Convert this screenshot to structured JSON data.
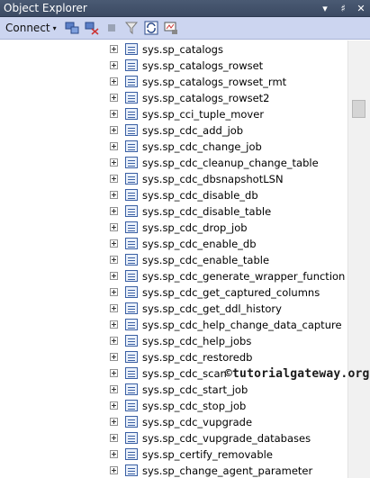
{
  "window": {
    "title": "Object Explorer"
  },
  "window_controls": {
    "dropdown": "▾",
    "pin": "♯",
    "close": "✕"
  },
  "toolbar": {
    "connect_label": "Connect",
    "connect_caret": "▾"
  },
  "tree": {
    "items": [
      "sys.sp_catalogs",
      "sys.sp_catalogs_rowset",
      "sys.sp_catalogs_rowset_rmt",
      "sys.sp_catalogs_rowset2",
      "sys.sp_cci_tuple_mover",
      "sys.sp_cdc_add_job",
      "sys.sp_cdc_change_job",
      "sys.sp_cdc_cleanup_change_table",
      "sys.sp_cdc_dbsnapshotLSN",
      "sys.sp_cdc_disable_db",
      "sys.sp_cdc_disable_table",
      "sys.sp_cdc_drop_job",
      "sys.sp_cdc_enable_db",
      "sys.sp_cdc_enable_table",
      "sys.sp_cdc_generate_wrapper_function",
      "sys.sp_cdc_get_captured_columns",
      "sys.sp_cdc_get_ddl_history",
      "sys.sp_cdc_help_change_data_capture",
      "sys.sp_cdc_help_jobs",
      "sys.sp_cdc_restoredb",
      "sys.sp_cdc_scan",
      "sys.sp_cdc_start_job",
      "sys.sp_cdc_stop_job",
      "sys.sp_cdc_vupgrade",
      "sys.sp_cdc_vupgrade_databases",
      "sys.sp_certify_removable",
      "sys.sp_change_agent_parameter"
    ]
  },
  "watermark": {
    "text": "©tutorialgateway.org"
  },
  "colors": {
    "titlebar": "#3b4a63",
    "toolbar": "#ccd5f0",
    "icon_blue": "#3a5fa3"
  }
}
